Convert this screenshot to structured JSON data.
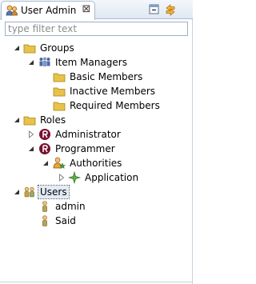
{
  "view": {
    "tab_title": "User Admin",
    "close_glyph": "⊠",
    "icons": {
      "tab": "users-tab-icon",
      "collapse_all": "collapse-all-icon",
      "link": "link-with-editor-icon"
    }
  },
  "filter": {
    "placeholder": "type filter text",
    "value": ""
  },
  "tree": {
    "groups": {
      "label": "Groups",
      "expanded": true,
      "item_managers": {
        "label": "Item Managers",
        "expanded": true,
        "children": [
          "Basic Members",
          "Inactive Members",
          "Required Members"
        ]
      }
    },
    "roles": {
      "label": "Roles",
      "expanded": true,
      "administrator": {
        "label": "Administrator",
        "expanded": false
      },
      "programmer": {
        "label": "Programmer",
        "expanded": true,
        "authorities": {
          "label": "Authorities",
          "expanded": true,
          "application": {
            "label": "Application",
            "expanded": false
          }
        }
      }
    },
    "users": {
      "label": "Users",
      "expanded": true,
      "selected": true,
      "children": [
        "admin",
        "Said"
      ]
    }
  },
  "colors": {
    "folder": "#e8c34a",
    "role_badge": "#7a1030",
    "authority": "#4a9a3a",
    "selection": "#e3ebf6",
    "tab_border": "#a9bccf"
  }
}
